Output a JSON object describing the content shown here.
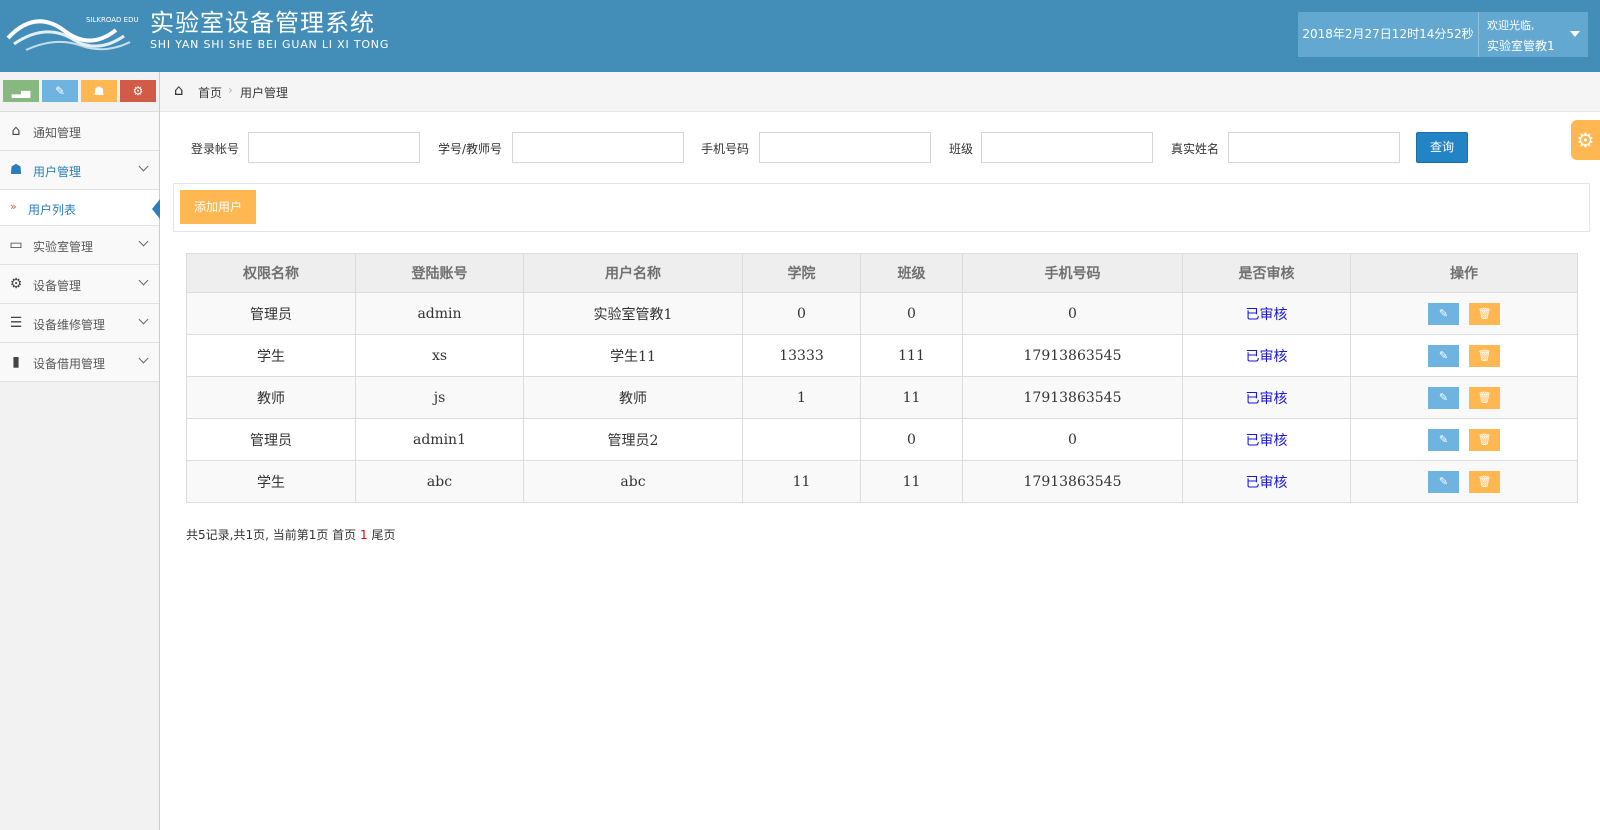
{
  "header": {
    "logo_text": "SILKROAD EDU",
    "title": "实验室设备管理系统",
    "subtitle": "SHI YAN SHI SHE BEI GUAN LI XI TONG",
    "datetime": "2018年2月27日12时14分52秒",
    "welcome": "欢迎光临,",
    "user_name": "实验室管教1"
  },
  "shortcuts": [
    {
      "icon": "signal-icon",
      "glyph": "▂▄",
      "color": "#87b87f"
    },
    {
      "icon": "pencil-icon",
      "glyph": "✎",
      "color": "#6fb3e0"
    },
    {
      "icon": "users-icon",
      "glyph": "☗",
      "color": "#ffb752"
    },
    {
      "icon": "cogs-icon",
      "glyph": "⚙",
      "color": "#d15b47"
    }
  ],
  "sidebar": {
    "items": [
      {
        "label": "通知管理",
        "icon": "home-icon",
        "glyph": "⌂"
      },
      {
        "label": "用户管理",
        "icon": "users-icon",
        "glyph": "☗"
      },
      {
        "label": "实验室管理",
        "icon": "desktop-icon",
        "glyph": "▭"
      },
      {
        "label": "设备管理",
        "icon": "cogs-icon",
        "glyph": "⚙"
      },
      {
        "label": "设备维修管理",
        "icon": "list-icon",
        "glyph": "☰"
      },
      {
        "label": "设备借用管理",
        "icon": "bookmark-icon",
        "glyph": "▮"
      }
    ],
    "sub_item": {
      "label": "用户列表",
      "arrow": "»"
    }
  },
  "breadcrumb": {
    "home": "首页",
    "sep": "›",
    "current": "用户管理"
  },
  "search": {
    "fields": [
      {
        "label": "登录帐号",
        "value": ""
      },
      {
        "label": "学号/教师号",
        "value": ""
      },
      {
        "label": "手机号码",
        "value": ""
      },
      {
        "label": "班级",
        "value": ""
      },
      {
        "label": "真实姓名",
        "value": ""
      }
    ],
    "query_label": "查询"
  },
  "add_label": "添加用户",
  "table": {
    "headers": [
      "权限名称",
      "登陆账号",
      "用户名称",
      "学院",
      "班级",
      "手机号码",
      "是否审核",
      "操作"
    ],
    "rows": [
      [
        "管理员",
        "admin",
        "实验室管教1",
        "0",
        "0",
        "0",
        "已审核"
      ],
      [
        "学生",
        "xs",
        "学生11",
        "13333",
        "111",
        "17913863545",
        "已审核"
      ],
      [
        "教师",
        "js",
        "教师",
        "1",
        "11",
        "17913863545",
        "已审核"
      ],
      [
        "管理员",
        "admin1",
        "管理员2",
        "",
        "0",
        "0",
        "已审核"
      ],
      [
        "学生",
        "abc",
        "abc",
        "11",
        "11",
        "17913863545",
        "已审核"
      ]
    ],
    "edit_glyph": "✎",
    "delete_glyph": "🗑"
  },
  "pager": {
    "prefix": "共5记录,共1页, 当前第1页 首页 ",
    "current": "1",
    "suffix": " 尾页"
  },
  "colors": {
    "header_bg": "#438eb9",
    "accent_blue": "#2283c5",
    "accent_orange": "#ffb752",
    "audit_text": "#1a18d8"
  }
}
